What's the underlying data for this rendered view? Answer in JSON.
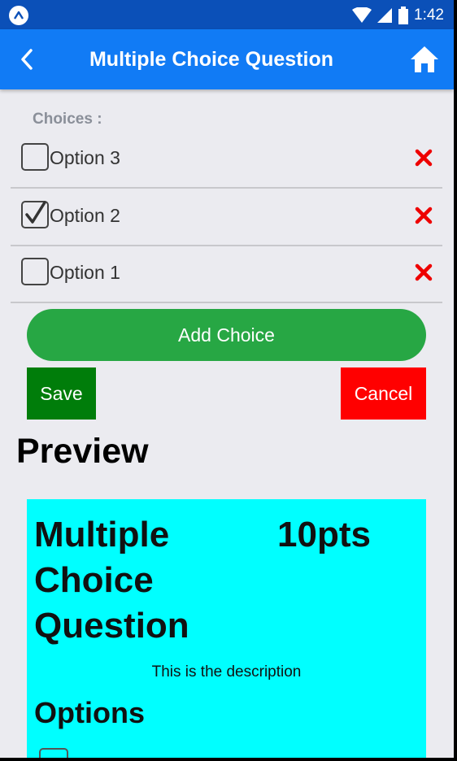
{
  "status_bar": {
    "time": "1:42"
  },
  "app_bar": {
    "title": "Multiple Choice Question"
  },
  "choices": {
    "label": "Choices :",
    "items": [
      {
        "label": "Option 3",
        "checked": false
      },
      {
        "label": "Option 2",
        "checked": true
      },
      {
        "label": "Option 1",
        "checked": false
      }
    ]
  },
  "buttons": {
    "add_choice": "Add Choice",
    "save": "Save",
    "cancel": "Cancel"
  },
  "preview": {
    "heading": "Preview",
    "title": "Multiple Choice Question",
    "points": "10pts",
    "description": "This is the description",
    "options_heading": "Options"
  },
  "colors": {
    "status_bar": "#0b50b8",
    "app_bar": "#117bf5",
    "add_button": "#27a744",
    "save_button": "#007d0a",
    "cancel_button": "#ff0000",
    "delete_icon": "#ee0000",
    "preview_card": "#00ffff"
  }
}
